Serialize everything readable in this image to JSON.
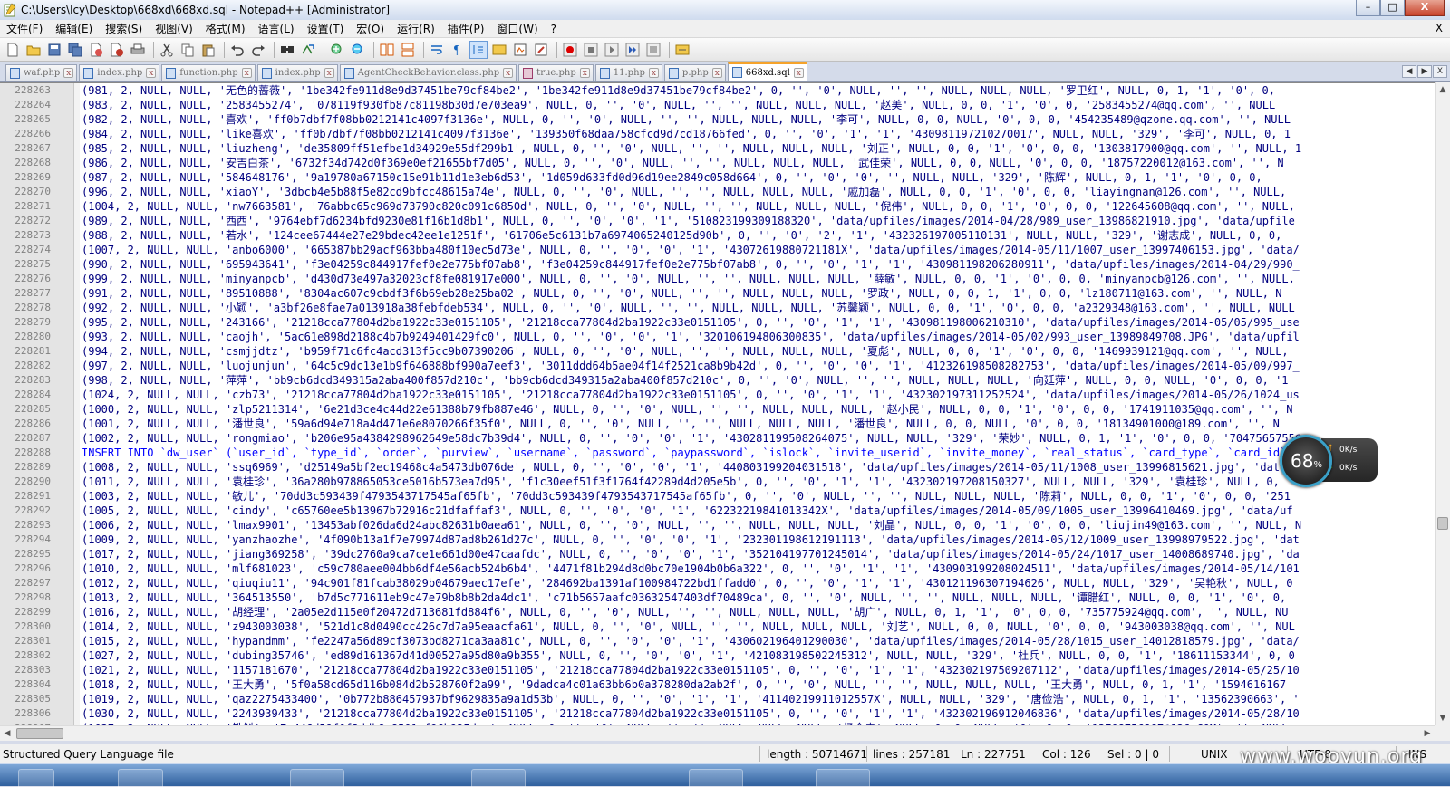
{
  "window": {
    "title": "C:\\Users\\lcy\\Desktop\\668xd\\668xd.sql - Notepad++ [Administrator]",
    "minimize": "–",
    "restore": "□",
    "close": "X"
  },
  "menu": {
    "items": [
      "文件(F)",
      "编辑(E)",
      "搜索(S)",
      "视图(V)",
      "格式(M)",
      "语言(L)",
      "设置(T)",
      "宏(O)",
      "运行(R)",
      "插件(P)",
      "窗口(W)",
      "?"
    ],
    "close_glyph": "X"
  },
  "toolbar": {
    "icons": [
      "new-file-icon",
      "open-file-icon",
      "save-icon",
      "save-all-icon",
      "close-file-icon",
      "close-all-icon",
      "print-icon",
      "cut-icon",
      "copy-icon",
      "paste-icon",
      "undo-icon",
      "redo-icon",
      "find-icon",
      "replace-icon",
      "zoom-in-icon",
      "zoom-out-icon",
      "sync-vertical-icon",
      "sync-horizontal-icon",
      "word-wrap-icon",
      "show-all-chars-icon",
      "indent-guide-icon",
      "user-lang-icon",
      "doc-map-icon",
      "function-list-icon",
      "record-macro-icon",
      "stop-record-icon",
      "play-macro-icon",
      "run-macro-multiple-icon",
      "save-macro-icon",
      "spellcheck-icon"
    ]
  },
  "tabs": [
    {
      "label": "waf.php",
      "active": false
    },
    {
      "label": "index.php",
      "active": false
    },
    {
      "label": "function.php",
      "active": false
    },
    {
      "label": "index.php",
      "active": false
    },
    {
      "label": "AgentCheckBehavior.class.php",
      "active": false
    },
    {
      "label": "true.php",
      "active": false
    },
    {
      "label": "11.php",
      "active": false
    },
    {
      "label": "p.php",
      "active": false
    },
    {
      "label": "668xd.sql",
      "active": true
    }
  ],
  "tab_close_glyph": "x",
  "tab_nav": {
    "prev": "◀",
    "next": "▶",
    "close": "X"
  },
  "editor": {
    "lines": [
      {
        "n": "228263",
        "t": "(981, 2, NULL, NULL, '无色的蔷薇', '1be342fe911d8e9d37451be79cf84be2', '1be342fe911d8e9d37451be79cf84be2', 0, '', '0', NULL, '', '', NULL, NULL, NULL, '罗卫红', NULL, 0, 1, '1', '0', 0,"
      },
      {
        "n": "228264",
        "t": "(983, 2, NULL, NULL, '2583455274', '078119f930fb87c81198b30d7e703ea9', NULL, 0, '', '0', NULL, '', '', NULL, NULL, NULL, '赵美', NULL, 0, 0, '1', '0', 0, '2583455274@qq.com', '', NULL"
      },
      {
        "n": "228265",
        "t": "(982, 2, NULL, NULL, '喜欢', 'ff0b7dbf7f08bb0212141c4097f3136e', NULL, 0, '', '0', NULL, '', '', NULL, NULL, NULL, '李可', NULL, 0, 0, NULL, '0', 0, 0, '454235489@qzone.qq.com', '', NULL"
      },
      {
        "n": "228266",
        "t": "(984, 2, NULL, NULL, 'like喜欢', 'ff0b7dbf7f08bb0212141c4097f3136e', '139350f68daa758cfcd9d7cd18766fed', 0, '', '0', '1', '1', '430981197210270017', NULL, NULL, '329', '李可', NULL, 0, 1"
      },
      {
        "n": "228267",
        "t": "(985, 2, NULL, NULL, 'liuzheng', 'de35809ff51efbe1d34929e55df299b1', NULL, 0, '', '0', NULL, '', '', NULL, NULL, NULL, '刘正', NULL, 0, 0, '1', '0', 0, 0, '1303817900@qq.com', '', NULL, 1"
      },
      {
        "n": "228268",
        "t": "(986, 2, NULL, NULL, '安吉白茶', '6732f34d742d0f369e0ef21655bf7d05', NULL, 0, '', '0', NULL, '', '', NULL, NULL, NULL, '武佳荣', NULL, 0, 0, NULL, '0', 0, 0, '18757220012@163.com', '', N"
      },
      {
        "n": "228269",
        "t": "(987, 2, NULL, NULL, '584648176', '9a19780a67150c15e91b11d1e3eb6d53', '1d059d633fd0d96d19ee2849c058d664', 0, '', '0', '0', '', NULL, NULL, '329', '陈辉', NULL, 0, 1, '1', '0', 0, 0,"
      },
      {
        "n": "228270",
        "t": "(996, 2, NULL, NULL, 'xiaoY', '3dbcb4e5b88f5e82cd9bfcc48615a74e', NULL, 0, '', '0', NULL, '', '', NULL, NULL, NULL, '戚加磊', NULL, 0, 0, '1', '0', 0, 0, 'liayingnan@126.com', '', NULL,"
      },
      {
        "n": "228271",
        "t": "(1004, 2, NULL, NULL, 'nw7663581', '76abbc65c969d73790c820c091c6850d', NULL, 0, '', '0', NULL, '', '', NULL, NULL, NULL, '倪伟', NULL, 0, 0, '1', '0', 0, 0, '122645608@qq.com', '', NULL,"
      },
      {
        "n": "228272",
        "t": "(989, 2, NULL, NULL, '西西', '9764ebf7d6234bfd9230e81f16b1d8b1', NULL, 0, '', '0', '0', '1', '510823199309188320', 'data/upfiles/images/2014-04/28/989_user_13986821910.jpg', 'data/upfile"
      },
      {
        "n": "228273",
        "t": "(988, 2, NULL, NULL, '若水', '124cee67444e27e29bdec42ee1e1251f', '61706e5c6131b7a6974065240125d90b', 0, '', '0', '2', '1', '432326197005110131', NULL, NULL, '329', '谢志成', NULL, 0, 0,"
      },
      {
        "n": "228274",
        "t": "(1007, 2, NULL, NULL, 'anbo6000', '665387bb29acf963bba480f10ec5d73e', NULL, 0, '', '0', '0', '1', '43072619880721181X', 'data/upfiles/images/2014-05/11/1007_user_13997406153.jpg', 'data/"
      },
      {
        "n": "228275",
        "t": "(990, 2, NULL, NULL, '695943641', 'f3e04259c844917fef0e2e775bf07ab8', 'f3e04259c844917fef0e2e775bf07ab8', 0, '', '0', '1', '1', '430981198206280911', 'data/upfiles/images/2014-04/29/990_"
      },
      {
        "n": "228276",
        "t": "(999, 2, NULL, NULL, 'minyanpcb', 'd430d73e497a32023cf8fe081917e000', NULL, 0, '', '0', NULL, '', '', NULL, NULL, NULL, '薛敏', NULL, 0, 0, '1', '0', 0, 0, 'minyanpcb@126.com', '', NULL,"
      },
      {
        "n": "228277",
        "t": "(991, 2, NULL, NULL, '89510888', '8304ac607c9cbdf3f6b69eb28e25ba02', NULL, 0, '', '0', NULL, '', '', NULL, NULL, NULL, '罗政', NULL, 0, 0, 1, '1', 0, 0, 'lz180711@163.com', '', NULL, N"
      },
      {
        "n": "228278",
        "t": "(992, 2, NULL, NULL, '小颖', 'a3bf26e8fae7a013918a38febfdeb534', NULL, 0, '', '0', NULL, '', '', NULL, NULL, NULL, '苏馨颖', NULL, 0, 0, '1', '0', 0, 0, 'a2329348@163.com', '', NULL, NULL"
      },
      {
        "n": "228279",
        "t": "(995, 2, NULL, NULL, '243166', '21218cca77804d2ba1922c33e0151105', '21218cca77804d2ba1922c33e0151105', 0, '', '0', '1', '1', '430981198006210310', 'data/upfiles/images/2014-05/05/995_use"
      },
      {
        "n": "228280",
        "t": "(993, 2, NULL, NULL, 'caojh', '5ac61e898d2188c4b7b9249401429fc0', NULL, 0, '', '0', '0', '1', '320106194806300835', 'data/upfiles/images/2014-05/02/993_user_13989849708.JPG', 'data/upfil"
      },
      {
        "n": "228281",
        "t": "(994, 2, NULL, NULL, 'csmjjdtz', 'b959f71c6fc4acd313f5cc9b07390206', NULL, 0, '', '0', NULL, '', '', NULL, NULL, NULL, '夏彪', NULL, 0, 0, '1', '0', 0, 0, '1469939121@qq.com', '', NULL,"
      },
      {
        "n": "228282",
        "t": "(997, 2, NULL, NULL, 'luojunjun', '64c5c9dc13e1b9f646888bf990a7eef3', '3011ddd64b5ae04f14f2521ca8b9b42d', 0, '', '0', '0', '1', '412326198508282753', 'data/upfiles/images/2014-05/09/997_"
      },
      {
        "n": "228283",
        "t": "(998, 2, NULL, NULL, '萍萍', 'bb9cb6dcd349315a2aba400f857d210c', 'bb9cb6dcd349315a2aba400f857d210c', 0, '', '0', NULL, '', '', NULL, NULL, NULL, '向延萍', NULL, 0, 0, NULL, '0', 0, 0, '1"
      },
      {
        "n": "228284",
        "t": "(1024, 2, NULL, NULL, 'czb73', '21218cca77804d2ba1922c33e0151105', '21218cca77804d2ba1922c33e0151105', 0, '', '0', '1', '1', '432302197311252524', 'data/upfiles/images/2014-05/26/1024_us"
      },
      {
        "n": "228285",
        "t": "(1000, 2, NULL, NULL, 'zlp5211314', '6e21d3ce4c44d22e61388b79fb887e46', NULL, 0, '', '0', NULL, '', '', NULL, NULL, NULL, '赵小民', NULL, 0, 0, '1', '0', 0, 0, '1741911035@qq.com', '', N"
      },
      {
        "n": "228286",
        "t": "(1001, 2, NULL, NULL, '潘世良', '59a6d94e718a4d471e6e8070266f35f0', NULL, 0, '', '0', NULL, '', '', NULL, NULL, NULL, '潘世良', NULL, 0, 0, NULL, '0', 0, 0, '18134901000@189.com', '', N"
      },
      {
        "n": "228287",
        "t": "(1002, 2, NULL, NULL, 'rongmiao', 'b206e95a4384298962649e58dc7b39d4', NULL, 0, '', '0', '0', '1', '430281199508264075', NULL, NULL, '329', '荣妙', NULL, 0, 1, '1', '0', 0, 0, '7047565755@"
      },
      {
        "n": "228288",
        "t": "INSERT INTO `dw_user` (`user_id`, `type_id`, `order`, `purview`, `username`, `password`, `paypassword`, `islock`, `invite_userid`, `invite_money`, `real_status`, `card_type`, `card_id`,",
        "kw": true
      },
      {
        "n": "228289",
        "t": "(1008, 2, NULL, NULL, 'ssq6969', 'd25149a5bf2ec19468c4a5473db076de', NULL, 0, '', '0', '0', '1', '440803199204031518', 'data/upfiles/images/2014-05/11/1008_user_13996815621.jpg', 'data/u"
      },
      {
        "n": "228290",
        "t": "(1011, 2, NULL, NULL, '袁桂珍', '36a280b978865053ce5016b573ea7d95', 'f1c30eef51f3f1764f42289d4d205e5b', 0, '', '0', '1', '1', '432302197208150327', NULL, NULL, '329', '袁桂珍', NULL, 0,"
      },
      {
        "n": "228291",
        "t": "(1003, 2, NULL, NULL, '敏儿', '70dd3c593439f4793543717545af65fb', '70dd3c593439f4793543717545af65fb', 0, '', '0', NULL, '', '', NULL, NULL, NULL, '陈莉', NULL, 0, 0, '1', '0', 0, 0, '251"
      },
      {
        "n": "228292",
        "t": "(1005, 2, NULL, NULL, 'cindy', 'c65760ee5b13967b72916c21dfaffaf3', NULL, 0, '', '0', '0', '1', '62232219841013342X', 'data/upfiles/images/2014-05/09/1005_user_13996410469.jpg', 'data/uf"
      },
      {
        "n": "228293",
        "t": "(1006, 2, NULL, NULL, 'lmax9901', '13453abf026da6d24abc82631b0aea61', NULL, 0, '', '0', NULL, '', '', NULL, NULL, NULL, '刘晶', NULL, 0, 0, '1', '0', 0, 0, 'liujin49@163.com', '', NULL, N"
      },
      {
        "n": "228294",
        "t": "(1009, 2, NULL, NULL, 'yanzhaozhe', '4f090b13a1f7e79974d87ad8b261d27c', NULL, 0, '', '0', '0', '1', '232301198612191113', 'data/upfiles/images/2014-05/12/1009_user_13998979522.jpg', 'dat"
      },
      {
        "n": "228295",
        "t": "(1017, 2, NULL, NULL, 'jiang369258', '39dc2760a9ca7ce1e661d00e47caafdc', NULL, 0, '', '0', '0', '1', '352104197701245014', 'data/upfiles/images/2014-05/24/1017_user_14008689740.jpg', 'da"
      },
      {
        "n": "228296",
        "t": "(1010, 2, NULL, NULL, 'mlf681023', 'c59c780aee004bb6df4e56acb524b6b4', '4471f81b294d8d0bc70e1904b0b6a322', 0, '', '0', '1', '1', '430903199208024511', 'data/upfiles/images/2014-05/14/101"
      },
      {
        "n": "228297",
        "t": "(1012, 2, NULL, NULL, 'qiuqiu11', '94c901f81fcab38029b04679aec17efe', '284692ba1391af100984722bd1ffadd0', 0, '', '0', '1', '1', '430121196307194626', NULL, NULL, '329', '吴艳秋', NULL, 0"
      },
      {
        "n": "228298",
        "t": "(1013, 2, NULL, NULL, '364513550', 'b7d5c771611eb9c47e79b8b8b2da4dc1', 'c71b5657aafc03632547403df70489ca', 0, '', '0', NULL, '', '', NULL, NULL, NULL, '谭腊红', NULL, 0, 0, '1', '0', 0,"
      },
      {
        "n": "228299",
        "t": "(1016, 2, NULL, NULL, '胡经理', '2a05e2d115e0f20472d713681fd884f6', NULL, 0, '', '0', NULL, '', '', NULL, NULL, NULL, '胡广', NULL, 0, 1, '1', '0', 0, 0, '735775924@qq.com', '', NULL, NU"
      },
      {
        "n": "228300",
        "t": "(1014, 2, NULL, NULL, 'z943003038', '521d1c8d0490cc426c7d7a95eaacfa61', NULL, 0, '', '0', NULL, '', '', NULL, NULL, NULL, '刘艺', NULL, 0, 0, NULL, '0', 0, 0, '943003038@qq.com', '', NUL"
      },
      {
        "n": "228301",
        "t": "(1015, 2, NULL, NULL, 'hypandmm', 'fe2247a56d89cf3073bd8271ca3aa81c', NULL, 0, '', '0', '0', '1', '430602196401290030', 'data/upfiles/images/2014-05/28/1015_user_14012818579.jpg', 'data/"
      },
      {
        "n": "228302",
        "t": "(1027, 2, NULL, NULL, 'dubing35746', 'ed89d161367d41d00527a95d80a9b355', NULL, 0, '', '0', '0', '1', '421083198502245312', NULL, NULL, '329', '杜兵', NULL, 0, 0, '1', '18611153344', 0, 0"
      },
      {
        "n": "228303",
        "t": "(1021, 2, NULL, NULL, '1157181670', '21218cca77804d2ba1922c33e0151105', '21218cca77804d2ba1922c33e0151105', 0, '', '0', '1', '1', '432302197509207112', 'data/upfiles/images/2014-05/25/10"
      },
      {
        "n": "228304",
        "t": "(1018, 2, NULL, NULL, '王大勇', '5f0a58cd65d116b084d2b528760f2a99', '9dadca4c01a63bb6b0a378280da2ab2f', 0, '', '0', NULL, '', '', NULL, NULL, NULL, '王大勇', NULL, 0, 1, '1', '1594616167"
      },
      {
        "n": "228305",
        "t": "(1019, 2, NULL, NULL, 'qaz2275433400', '0b772b886457937bf9629835a9a1d53b', NULL, 0, '', '0', '1', '1', '41140219911012557X', NULL, NULL, '329', '唐俭浩', NULL, 0, 1, '1', '13562390663', '"
      },
      {
        "n": "228306",
        "t": "(1030, 2, NULL, NULL, '2243939433', '21218cca77804d2ba1922c33e0151105', '21218cca77804d2ba1922c33e0151105', 0, '', '0', '1', '1', '432302196912046836', 'data/upfiles/images/2014-05/28/10"
      },
      {
        "n": "228307",
        "t": "(1037, 2, NULL, NULL, '铁斛', '7a446d59f0f3ddb8a8501ef96b925dac', NULL, 0, '', '0', NULL, '', '', NULL, NULL, NULL, '杨金忠', NULL, 0, 0, NULL, '0', 0, 0, '13708756287@126.COM', '', NULL"
      }
    ]
  },
  "statusbar": {
    "filetype": "Structured Query Language file",
    "length": "length : 50714671",
    "lines": "lines : 257181",
    "ln": "Ln : 227751",
    "col": "Col : 126",
    "sel": "Sel : 0 | 0",
    "eol": "UNIX",
    "encoding": "UTF-8",
    "mode": "INS"
  },
  "speed_widget": {
    "percent": "68",
    "percent_sign": "%",
    "up": "0K/s",
    "down": "0K/s"
  },
  "watermark": "www.wooyun.org",
  "colors": {
    "code_text": "#000080",
    "keyword": "#0000ff",
    "active_tab_accent": "#f5a32b"
  }
}
